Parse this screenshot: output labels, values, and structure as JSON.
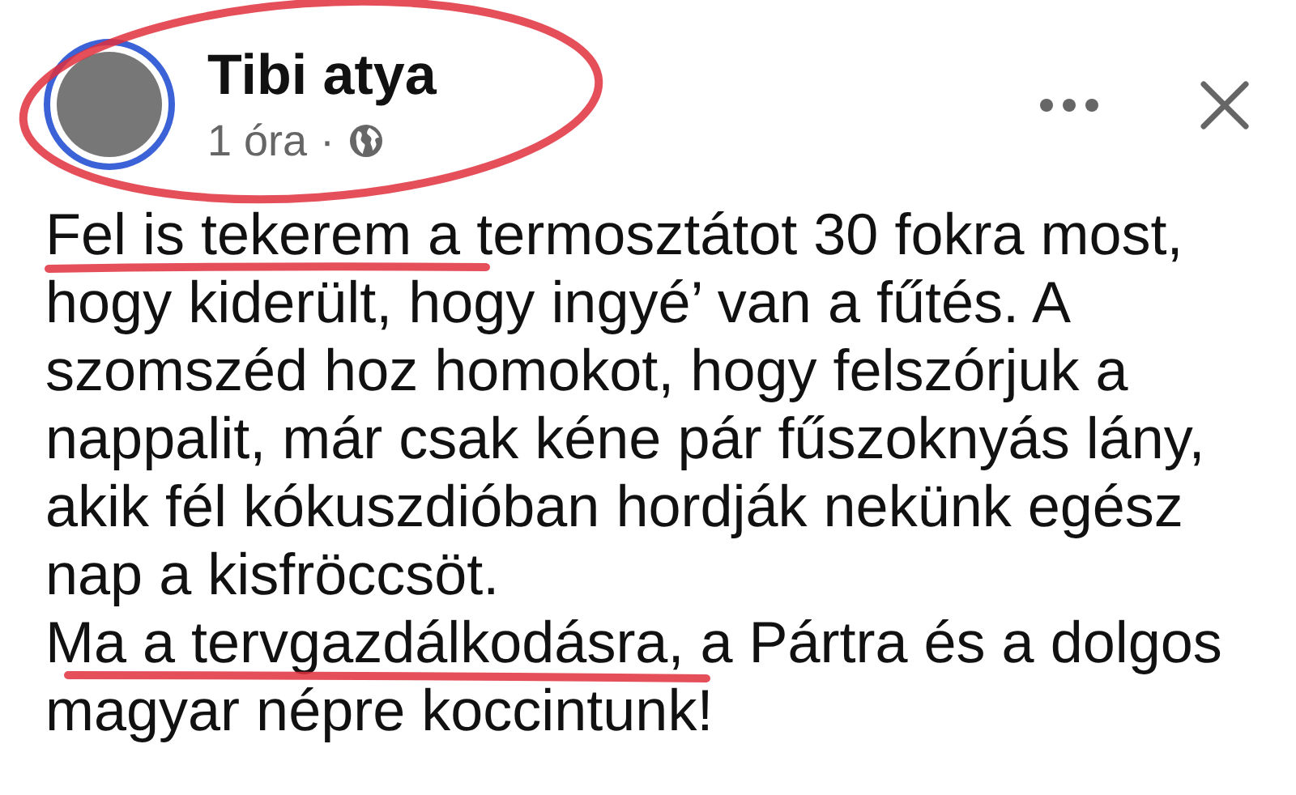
{
  "post": {
    "author": "Tibi atya",
    "time": "1 óra",
    "separator": "·",
    "paragraphs": [
      [
        "Fel is tekerem a termosztátot 30 fokra most,",
        "hogy kiderült, hogy ingyé’ van a fűtés. A",
        "szomszéd hoz homokot, hogy felszórjuk a",
        "nappalit, már csak kéne pár fűszoknyás lány,",
        "akik fél kókuszdióban hordják nekünk egész",
        "nap a kisfröccsöt."
      ],
      [
        "Ma a tervgazdálkodásra, a Pártra és a dolgos",
        "magyar népre koccintunk!"
      ]
    ]
  }
}
